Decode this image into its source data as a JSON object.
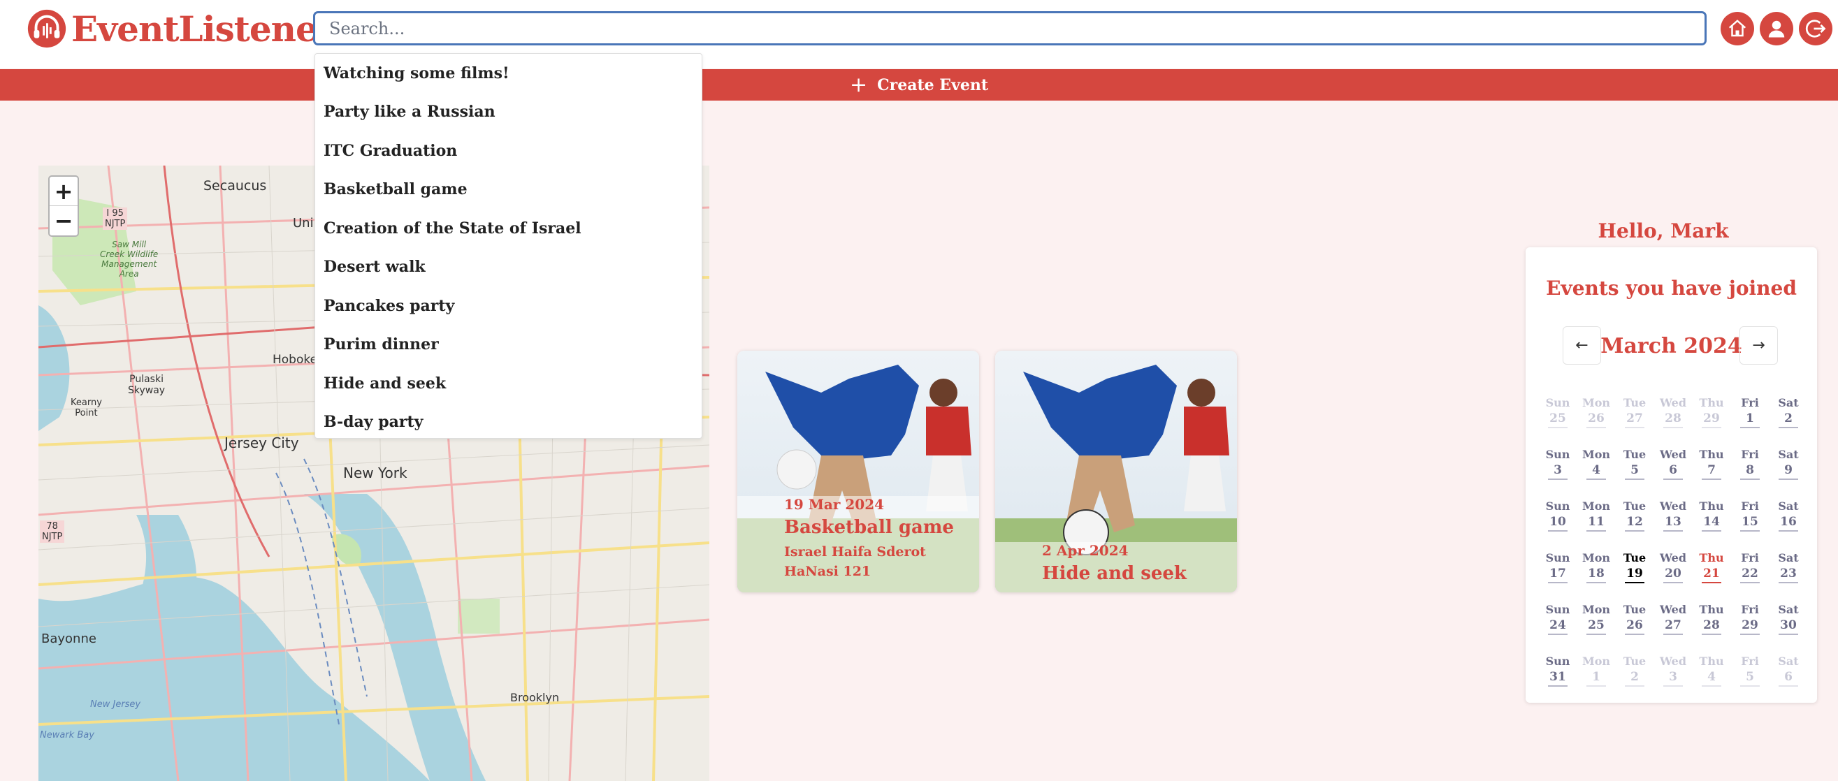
{
  "app": {
    "name": "EventListener",
    "brand_color": "#d5473f"
  },
  "header": {
    "search_placeholder": "Search...",
    "icons": [
      "home-icon",
      "user-icon",
      "logout-icon"
    ]
  },
  "create_bar": {
    "label": "Create Event"
  },
  "search_suggestions": [
    "Watching some films!",
    "Party like a Russian",
    "ITC Graduation",
    "Basketball game",
    "Creation of the State of Israel",
    "Desert walk",
    "Pancakes party",
    "Purim dinner",
    "Hide and seek",
    "B-day party"
  ],
  "map": {
    "labels": [
      "Secaucus",
      "I 95\nNJTP",
      "Saw Mill\nCreek Wildlife\nManagement\nArea",
      "Pulaski\nSkyway",
      "Kearny\nPoint",
      "Jersey City",
      "Hoboken",
      "New York",
      "Bayonne",
      "Brooklyn",
      "New Jersey",
      "Newark Bay",
      "78\nNJTP",
      "Uni"
    ]
  },
  "cards": [
    {
      "date": "19 Mar 2024",
      "title": "Basketball game",
      "address": "Israel Haifa Sderot HaNasi 121"
    },
    {
      "date": "2 Apr 2024",
      "title": "Hide and seek",
      "address": ""
    }
  ],
  "sidebar": {
    "greeting": "Hello, Mark",
    "calendar_title": "Events you have joined",
    "month_label": "March 2024",
    "prev_icon": "arrow-left-icon",
    "next_icon": "arrow-right-icon",
    "today": 19,
    "event_days": [
      21
    ],
    "weeks": [
      [
        {
          "dn": "Sun",
          "d": "25",
          "m": true
        },
        {
          "dn": "Mon",
          "d": "26",
          "m": true
        },
        {
          "dn": "Tue",
          "d": "27",
          "m": true
        },
        {
          "dn": "Wed",
          "d": "28",
          "m": true
        },
        {
          "dn": "Thu",
          "d": "29",
          "m": true
        },
        {
          "dn": "Fri",
          "d": "1"
        },
        {
          "dn": "Sat",
          "d": "2"
        }
      ],
      [
        {
          "dn": "Sun",
          "d": "3"
        },
        {
          "dn": "Mon",
          "d": "4"
        },
        {
          "dn": "Tue",
          "d": "5"
        },
        {
          "dn": "Wed",
          "d": "6"
        },
        {
          "dn": "Thu",
          "d": "7"
        },
        {
          "dn": "Fri",
          "d": "8"
        },
        {
          "dn": "Sat",
          "d": "9"
        }
      ],
      [
        {
          "dn": "Sun",
          "d": "10"
        },
        {
          "dn": "Mon",
          "d": "11"
        },
        {
          "dn": "Tue",
          "d": "12"
        },
        {
          "dn": "Wed",
          "d": "13"
        },
        {
          "dn": "Thu",
          "d": "14"
        },
        {
          "dn": "Fri",
          "d": "15"
        },
        {
          "dn": "Sat",
          "d": "16"
        }
      ],
      [
        {
          "dn": "Sun",
          "d": "17"
        },
        {
          "dn": "Mon",
          "d": "18"
        },
        {
          "dn": "Tue",
          "d": "19",
          "t": true
        },
        {
          "dn": "Wed",
          "d": "20"
        },
        {
          "dn": "Thu",
          "d": "21",
          "e": true
        },
        {
          "dn": "Fri",
          "d": "22"
        },
        {
          "dn": "Sat",
          "d": "23"
        }
      ],
      [
        {
          "dn": "Sun",
          "d": "24"
        },
        {
          "dn": "Mon",
          "d": "25"
        },
        {
          "dn": "Tue",
          "d": "26"
        },
        {
          "dn": "Wed",
          "d": "27"
        },
        {
          "dn": "Thu",
          "d": "28"
        },
        {
          "dn": "Fri",
          "d": "29"
        },
        {
          "dn": "Sat",
          "d": "30"
        }
      ],
      [
        {
          "dn": "Sun",
          "d": "31"
        },
        {
          "dn": "Mon",
          "d": "1",
          "m": true
        },
        {
          "dn": "Tue",
          "d": "2",
          "m": true
        },
        {
          "dn": "Wed",
          "d": "3",
          "m": true
        },
        {
          "dn": "Thu",
          "d": "4",
          "m": true
        },
        {
          "dn": "Fri",
          "d": "5",
          "m": true
        },
        {
          "dn": "Sat",
          "d": "6",
          "m": true
        }
      ]
    ]
  }
}
